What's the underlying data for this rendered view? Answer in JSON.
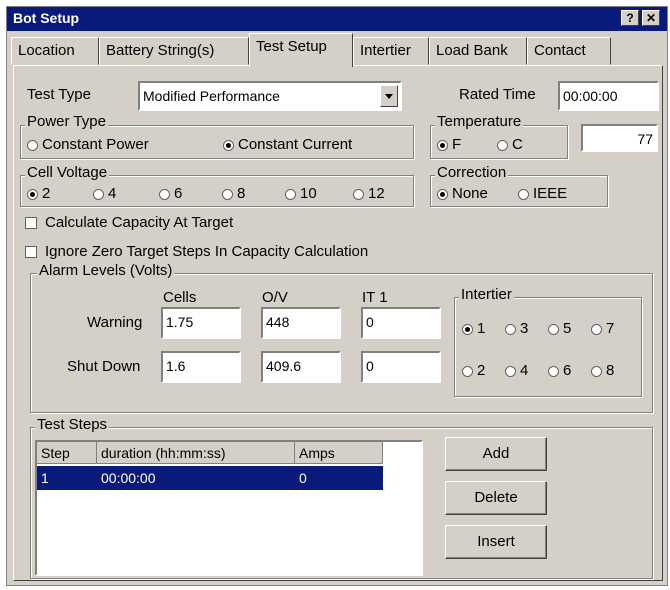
{
  "window": {
    "title": "Bot Setup",
    "help_label": "?",
    "close_label": "✕"
  },
  "tabs": [
    "Location",
    "Battery String(s)",
    "Test Setup",
    "Intertier",
    "Load Bank",
    "Contact"
  ],
  "active_tab": "Test Setup",
  "test_type": {
    "label": "Test Type",
    "value": "Modified Performance"
  },
  "rated_time": {
    "label": "Rated Time",
    "value": "00:00:00"
  },
  "power_type": {
    "label": "Power Type",
    "options": [
      "Constant Power",
      "Constant Current"
    ],
    "selected": "Constant Current"
  },
  "temperature": {
    "label": "Temperature",
    "options": [
      "F",
      "C"
    ],
    "selected": "F",
    "value": "77"
  },
  "cell_voltage": {
    "label": "Cell Voltage",
    "options": [
      "2",
      "4",
      "6",
      "8",
      "10",
      "12"
    ],
    "selected": "2"
  },
  "correction": {
    "label": "Correction",
    "options": [
      "None",
      "IEEE"
    ],
    "selected": "None"
  },
  "checkboxes": {
    "calc_capacity": {
      "label": "Calculate Capacity At Target",
      "checked": false
    },
    "ignore_zero": {
      "label": "Ignore Zero Target Steps In Capacity Calculation",
      "checked": false
    }
  },
  "alarm_levels": {
    "label": "Alarm Levels (Volts)",
    "columns": [
      "Cells",
      "O/V",
      "IT 1"
    ],
    "warning": {
      "label": "Warning",
      "values": [
        "1.75",
        "448",
        "0"
      ]
    },
    "shutdown": {
      "label": "Shut Down",
      "values": [
        "1.6",
        "409.6",
        "0"
      ]
    }
  },
  "intertier": {
    "label": "Intertier",
    "options": [
      "1",
      "3",
      "5",
      "7",
      "2",
      "4",
      "6",
      "8"
    ],
    "selected": "1"
  },
  "test_steps": {
    "label": "Test Steps",
    "columns": [
      "Step",
      "duration (hh:mm:ss)",
      "Amps"
    ],
    "rows": [
      {
        "step": "1",
        "duration": "00:00:00",
        "amps": "0"
      }
    ]
  },
  "buttons": {
    "add": "Add",
    "delete": "Delete",
    "insert": "Insert"
  }
}
